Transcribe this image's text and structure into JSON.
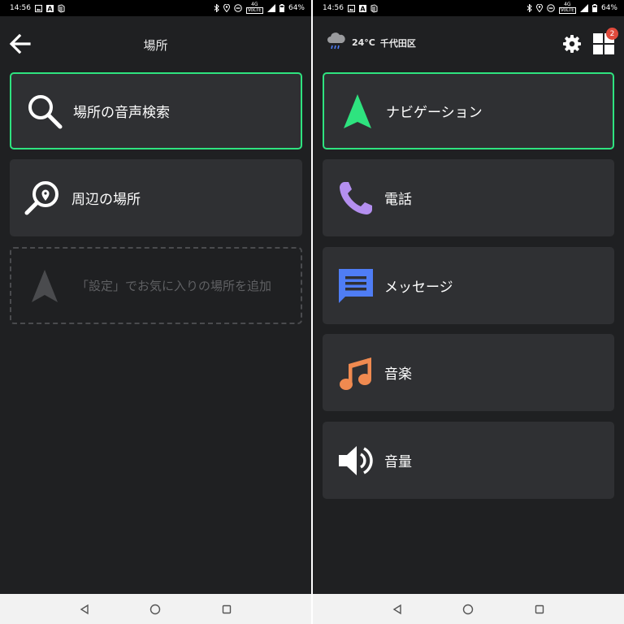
{
  "left": {
    "status": {
      "time": "14:56",
      "battery": "64%",
      "network_top": "4G",
      "network_bottom": "VoLTE"
    },
    "header": {
      "title": "場所"
    },
    "items": [
      {
        "label": "場所の音声検索"
      },
      {
        "label": "周辺の場所"
      },
      {
        "label": "「設定」でお気に入りの場所を追加"
      }
    ]
  },
  "right": {
    "status": {
      "time": "14:56",
      "battery": "64%",
      "network_top": "4G",
      "network_bottom": "VoLTE"
    },
    "header": {
      "temperature": "24°C",
      "location": "千代田区",
      "badge_count": "2"
    },
    "items": [
      {
        "label": "ナビゲーション",
        "icon": "navigation-arrow-icon",
        "color": "#2ee37f"
      },
      {
        "label": "電話",
        "icon": "phone-icon",
        "color": "#b48ff0"
      },
      {
        "label": "メッセージ",
        "icon": "message-icon",
        "color": "#4f7df5"
      },
      {
        "label": "音楽",
        "icon": "music-note-icon",
        "color": "#f08a50"
      },
      {
        "label": "音量",
        "icon": "speaker-icon",
        "color": "#ffffff"
      }
    ]
  },
  "colors": {
    "background": "#1f2022",
    "card": "#2f3033",
    "accent": "#2ee37f"
  }
}
